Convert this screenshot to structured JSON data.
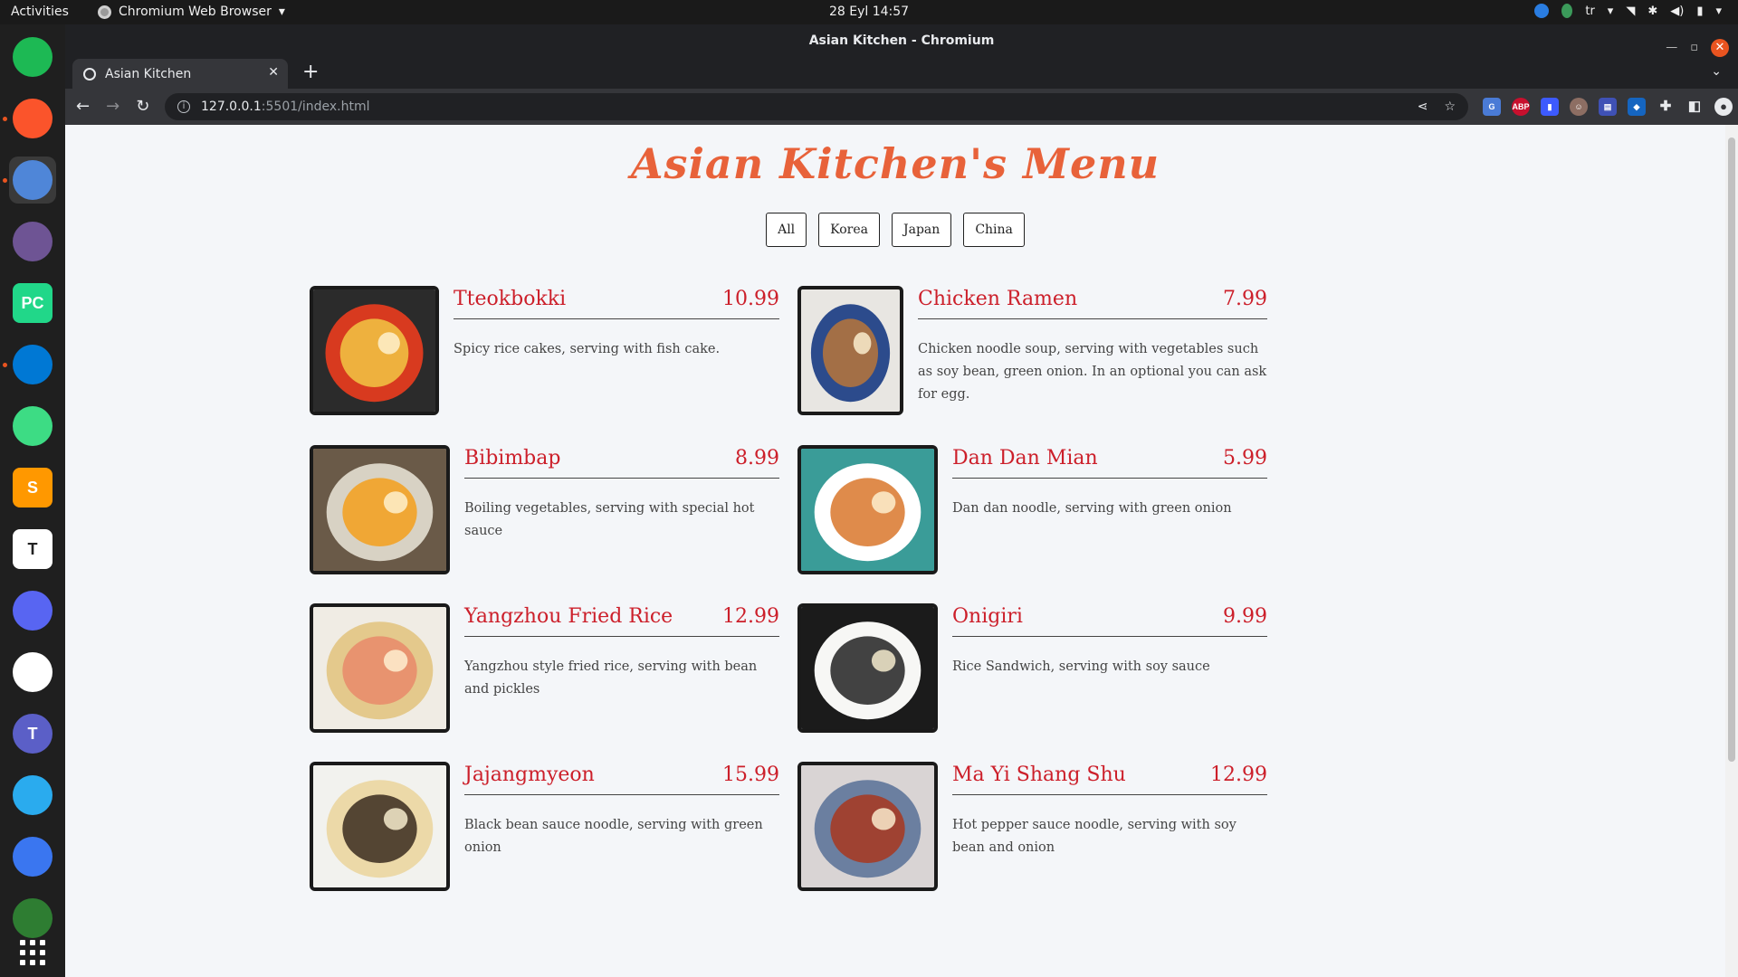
{
  "topbar": {
    "activities": "Activities",
    "app_name": "Chromium Web Browser",
    "clock": "28 Eyl  14:57",
    "keyboard_layout": "tr"
  },
  "dock": {
    "items": [
      {
        "name": "spotify",
        "letter": "",
        "color": "#1db954"
      },
      {
        "name": "brave",
        "letter": "",
        "color": "#fb542b"
      },
      {
        "name": "chromium",
        "letter": "",
        "color": "#4f86d8"
      },
      {
        "name": "github-desktop",
        "letter": "",
        "color": "#6e5494"
      },
      {
        "name": "pycharm",
        "letter": "PC",
        "color": "#21d789"
      },
      {
        "name": "vscode",
        "letter": "",
        "color": "#0078d4"
      },
      {
        "name": "android-studio",
        "letter": "",
        "color": "#3ddc84"
      },
      {
        "name": "sublime-text",
        "letter": "S",
        "color": "#ff9800"
      },
      {
        "name": "typora",
        "letter": "T",
        "color": "#ffffff"
      },
      {
        "name": "discord",
        "letter": "",
        "color": "#5865f2"
      },
      {
        "name": "slack",
        "letter": "",
        "color": "#ffffff"
      },
      {
        "name": "teams",
        "letter": "T",
        "color": "#5b5fc7"
      },
      {
        "name": "telegram",
        "letter": "",
        "color": "#2aabee"
      },
      {
        "name": "signal",
        "letter": "",
        "color": "#3a76f0"
      },
      {
        "name": "partial-app",
        "letter": "",
        "color": "#2e7d32"
      }
    ],
    "apps_grid_icon": "apps-grid-icon"
  },
  "window": {
    "title": "Asian Kitchen - Chromium",
    "tab_title": "Asian Kitchen",
    "url_host": "127.0.0.1",
    "url_rest": ":5501/index.html"
  },
  "page": {
    "title": "Asian Kitchen's Menu",
    "filters": [
      "All",
      "Korea",
      "Japan",
      "China"
    ],
    "items": [
      {
        "name": "Tteokbokki",
        "price": "10.99",
        "desc": "Spicy rice cakes, serving with fish cake.",
        "food_colors": [
          "#2b2b2b",
          "#d83a1f",
          "#f2c744"
        ]
      },
      {
        "name": "Chicken Ramen",
        "price": "7.99",
        "desc": "Chicken noodle soup, serving with vegetables such as soy bean, green onion. In an optional you can ask for egg.",
        "food_colors": [
          "#e8e6e2",
          "#2c4b8c",
          "#b8763a"
        ]
      },
      {
        "name": "Bibimbap",
        "price": "8.99",
        "desc": "Boiling vegetables, serving with special hot sauce",
        "food_colors": [
          "#6a5a48",
          "#d8d2c4",
          "#f4a01c"
        ]
      },
      {
        "name": "Dan Dan Mian",
        "price": "5.99",
        "desc": "Dan dan noodle, serving with green onion",
        "food_colors": [
          "#3a9c98",
          "#ffffff",
          "#d9772b"
        ]
      },
      {
        "name": "Yangzhou Fried Rice",
        "price": "12.99",
        "desc": "Yangzhou style fried rice, serving with bean and pickles",
        "food_colors": [
          "#f0ece4",
          "#e4c98c",
          "#e98a6a"
        ]
      },
      {
        "name": "Onigiri",
        "price": "9.99",
        "desc": "Rice Sandwich, serving with soy sauce",
        "food_colors": [
          "#1b1b1b",
          "#f7f7f5",
          "#222222"
        ]
      },
      {
        "name": "Jajangmyeon",
        "price": "15.99",
        "desc": "Black bean sauce noodle, serving with green onion",
        "food_colors": [
          "#f2f2ee",
          "#ecd9a8",
          "#3a2a1e"
        ]
      },
      {
        "name": "Ma Yi Shang Shu",
        "price": "12.99",
        "desc": "Hot pepper sauce noodle, serving with soy bean and onion",
        "food_colors": [
          "#d9d4d4",
          "#6b7fa0",
          "#a8371f"
        ]
      }
    ]
  },
  "colors": {
    "title": "#e8623a",
    "accent": "#cc1f2a",
    "page_bg": "#f4f6f9"
  }
}
